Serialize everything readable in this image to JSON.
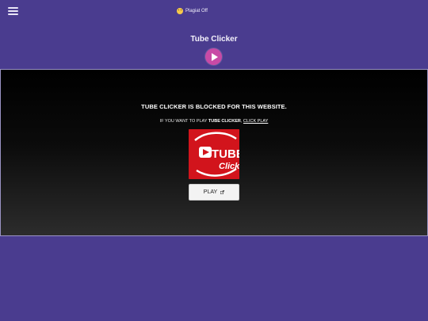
{
  "topbar": {
    "plagiat_label": "Plagiat Off",
    "plagiat_icon": "emoji-icon",
    "menu_icon": "hamburger-menu-icon"
  },
  "game": {
    "title": "Tube Clicker",
    "blocked_message": "TUBE CLICKER IS BLOCKED FOR THIS WEBSITE.",
    "sub_prefix": "IF YOU WANT TO PLAY",
    "sub_game_name": "TUBE CLICKER",
    "sub_link": "CLICK PLAY",
    "thumbnail_text_top": "TUBE",
    "thumbnail_text_bottom": "Clicker",
    "play_button_label": "PLAY"
  },
  "colors": {
    "background": "#4a3c8f",
    "accent": "#c84aa6",
    "thumbnail_red": "#d2141c"
  }
}
